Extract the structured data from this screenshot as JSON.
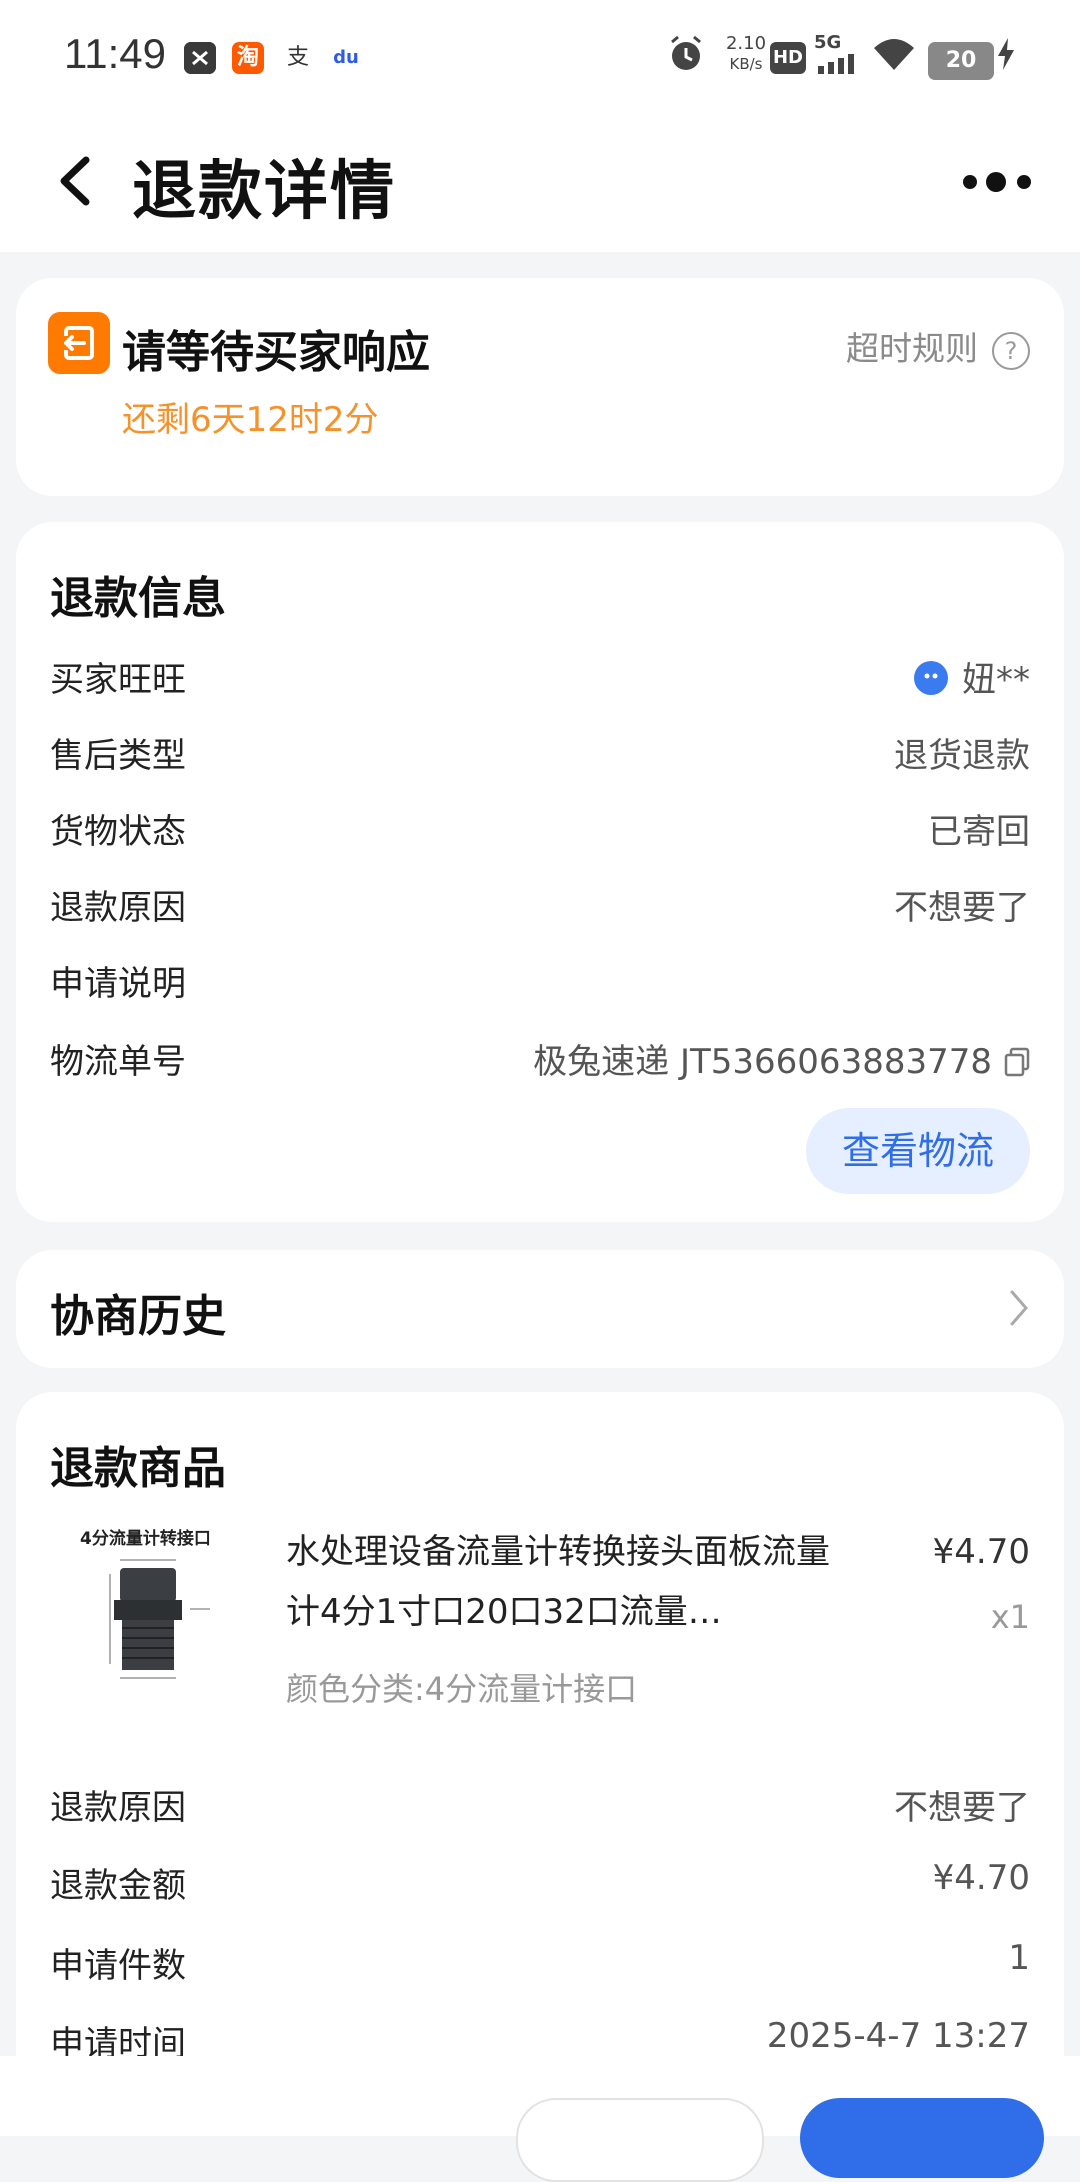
{
  "status_bar": {
    "time": "11:49",
    "apps": [
      "tools-icon",
      "taobao-icon",
      "alipay-icon",
      "baidu-icon"
    ],
    "taobao_glyph": "淘",
    "alipay_glyph": "支",
    "baidu_glyph": "du",
    "net_speed_value": "2.10",
    "net_speed_unit": "KB/s",
    "hd_label": "HD",
    "network_label": "5G",
    "battery_level": "20"
  },
  "nav": {
    "title": "退款详情"
  },
  "status_card": {
    "title": "请等待买家响应",
    "countdown": "还剩6天12时2分",
    "rule_link": "超时规则",
    "help_glyph": "?"
  },
  "refund_info": {
    "section_title": "退款信息",
    "rows": [
      {
        "label": "买家旺旺",
        "value": "妞**"
      },
      {
        "label": "售后类型",
        "value": "退货退款"
      },
      {
        "label": "货物状态",
        "value": "已寄回"
      },
      {
        "label": "退款原因",
        "value": "不想要了"
      },
      {
        "label": "申请说明",
        "value": ""
      },
      {
        "label": "物流单号",
        "value": "极兔速递 JT5366063883778"
      }
    ],
    "logistics_button": "查看物流"
  },
  "history": {
    "title": "协商历史"
  },
  "refund_goods": {
    "section_title": "退款商品",
    "product": {
      "thumb_caption": "4分流量计转接口",
      "name": "水处理设备流量计转换接头面板流量计4分1寸口20口32口流量…",
      "sku": "颜色分类:4分流量计接口",
      "price": "¥4.70",
      "qty": "x1"
    },
    "rows": [
      {
        "label": "退款原因",
        "value": "不想要了"
      },
      {
        "label": "退款金额",
        "value": "¥4.70"
      },
      {
        "label": "申请件数",
        "value": "1"
      },
      {
        "label": "申请时间",
        "value": "2025-4-7 13:27"
      }
    ]
  },
  "colors": {
    "accent_blue": "#2f6ee8",
    "orange": "#ff7a00",
    "countdown_orange": "#f5922b",
    "background": "#f4f5f7"
  }
}
